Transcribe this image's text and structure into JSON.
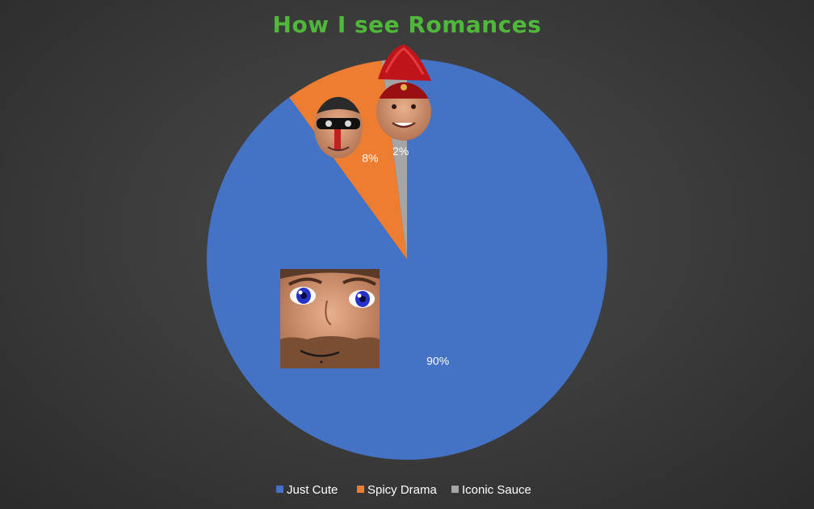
{
  "chart_data": {
    "type": "pie",
    "title": "How I see Romances",
    "categories": [
      "Just Cute",
      "Spicy Drama",
      "Iconic Sauce"
    ],
    "values": [
      90,
      8,
      2
    ],
    "data_labels": [
      "90%",
      "8%",
      "2%"
    ],
    "colors": [
      "#4472c4",
      "#ed7d31",
      "#a5a5a5"
    ],
    "legend_position": "bottom",
    "start_angle_deg": 0,
    "direction": "clockwise"
  },
  "decorations": [
    {
      "name": "face-sticker-blue-eyes-icon",
      "slice": "Just Cute"
    },
    {
      "name": "face-sticker-face-paint-icon",
      "slice": "Spicy Drama"
    },
    {
      "name": "face-sticker-feather-hat-icon",
      "slice": "Iconic Sauce"
    }
  ]
}
